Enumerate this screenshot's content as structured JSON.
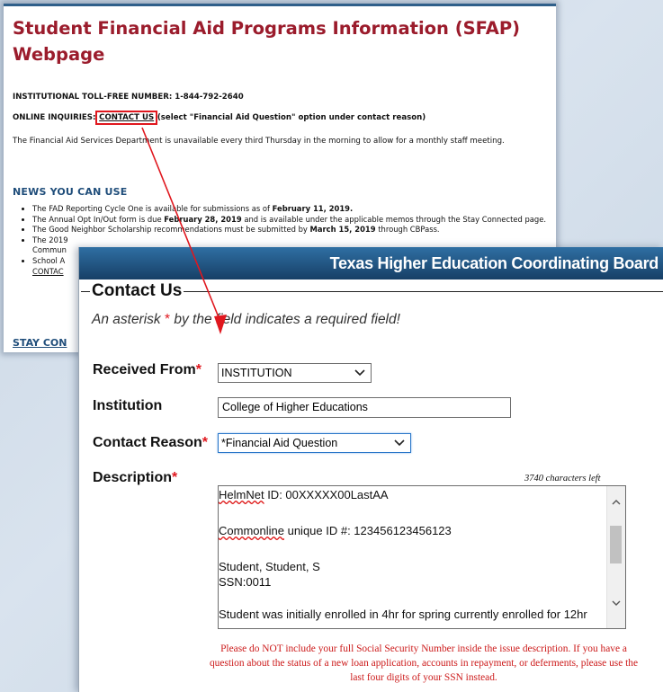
{
  "sfap": {
    "title": "Student Financial Aid Programs Information (SFAP) Webpage",
    "tollfree_label": "INSTITUTIONAL TOLL-FREE NUMBER: 1-844-792-2640",
    "online_label": "ONLINE INQUIRIES:",
    "contact_link": "CONTACT US",
    "online_suffix": "(select \"Financial Aid Question\" option under contact reason)",
    "unavailable_notice": "The Financial Aid Services Department is unavailable every third Thursday in the morning to allow for a monthly staff meeting.",
    "news_heading": "NEWS YOU CAN USE",
    "news": [
      {
        "pre": "The FAD Reporting Cycle One is available for submissions as of ",
        "bold": "February 11, 2019.",
        "post": ""
      },
      {
        "pre": "The Annual Opt In/Out form is due ",
        "bold": "February 28, 2019",
        "post": " and is available under the applicable memos through the Stay Connected page."
      },
      {
        "pre": "The Good Neighbor Scholarship recommendations must be submitted by ",
        "bold": "March 15, 2019",
        "post": " through CBPass."
      },
      {
        "pre": "The 2019",
        "bold": "",
        "post": ""
      },
      {
        "pre": "Commun",
        "bold": "",
        "post": ""
      },
      {
        "pre": "School A",
        "bold": "",
        "post": ""
      },
      {
        "pre": "CONTAC",
        "bold": "",
        "post": ""
      }
    ],
    "stay_connected": "STAY CON"
  },
  "thecb": {
    "header": "Texas Higher Education Coordinating Board",
    "legend": "Contact Us",
    "required_note_pre": "An asterisk ",
    "required_star": "*",
    "required_note_post": " by the field indicates a required field!",
    "fields": {
      "received_from": {
        "label": "Received From",
        "value": "INSTITUTION"
      },
      "institution": {
        "label": "Institution",
        "value": "College of Higher Educations"
      },
      "contact_reason": {
        "label": "Contact Reason",
        "value": "*Financial Aid Question"
      },
      "description": {
        "label": "Description",
        "chars_left": "3740 characters left",
        "line1_spell": "HelmNet",
        "line1_rest": " ID: 00XXXXX00LastAA",
        "line2_spell": "Commonline",
        "line2_rest": " unique ID #: 123456123456123",
        "line3": "Student, Student, S",
        "line4": "SSN:0011",
        "line5": "Student was initially enrolled in 4hr for spring currently enrolled for 12hr"
      }
    },
    "required_marker": "*",
    "warning": "Please do NOT include your full Social Security Number inside the issue description. If you have a question about the status of a new loan application, accounts in repayment, or deferments, please use the last four digits of your SSN instead."
  },
  "colors": {
    "title_red": "#9b1c2c",
    "heading_blue": "#1f4d7a",
    "highlight_red": "#e0171e",
    "header_bar": "#1f4f7c"
  }
}
